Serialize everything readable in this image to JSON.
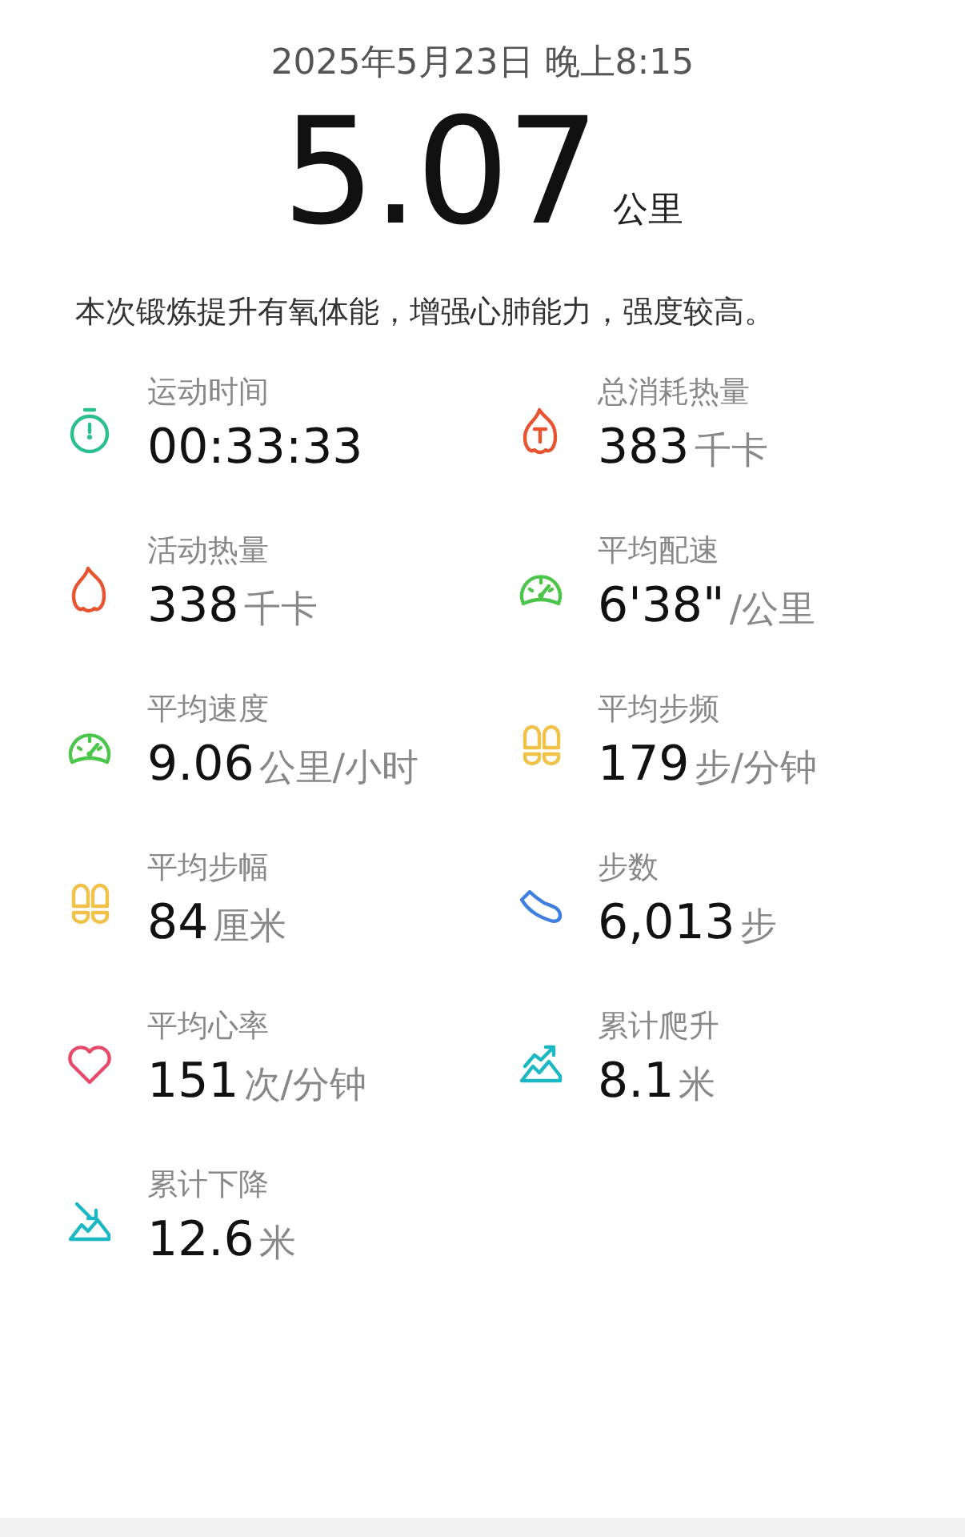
{
  "header": {
    "date": "2025年5月23日 晚上8:15",
    "distance": "5.07",
    "distance_unit": "公里"
  },
  "summary": "本次锻炼提升有氧体能，增强心肺能力，强度较高。",
  "stats": [
    {
      "label": "运动时间",
      "value": "00:33:33",
      "kind": "stopwatch",
      "color": "#2bbf8f"
    },
    {
      "label": "总消耗热量",
      "value": "383",
      "unit": "千卡",
      "kind": "flame-total",
      "color": "#e8542f"
    },
    {
      "label": "活动热量",
      "value": "338",
      "unit": "千卡",
      "kind": "flame",
      "color": "#e8542f"
    },
    {
      "label": "平均配速",
      "value": "6'38\"",
      "unit": "/公里",
      "kind": "gauge",
      "color": "#4cc64a"
    },
    {
      "label": "平均速度",
      "value": "9.06",
      "unit": "公里/小时",
      "kind": "gauge",
      "color": "#4cc64a"
    },
    {
      "label": "平均步频",
      "value": "179",
      "unit": "步/分钟",
      "kind": "footprints",
      "color": "#f0c24a"
    },
    {
      "label": "平均步幅",
      "value": "84",
      "unit": "厘米",
      "kind": "footprints",
      "color": "#f0c24a"
    },
    {
      "label": "步数",
      "value": "6,013",
      "unit": "步",
      "kind": "shoe",
      "color": "#3f7fe0"
    },
    {
      "label": "平均心率",
      "value": "151",
      "unit": "次/分钟",
      "kind": "heart",
      "color": "#e84a6a"
    },
    {
      "label": "累计爬升",
      "value": "8.1",
      "unit": "米",
      "kind": "ascent",
      "color": "#1db8c4"
    },
    {
      "label": "累计下降",
      "value": "12.6",
      "unit": "米",
      "kind": "descent",
      "color": "#1db8c4"
    }
  ]
}
